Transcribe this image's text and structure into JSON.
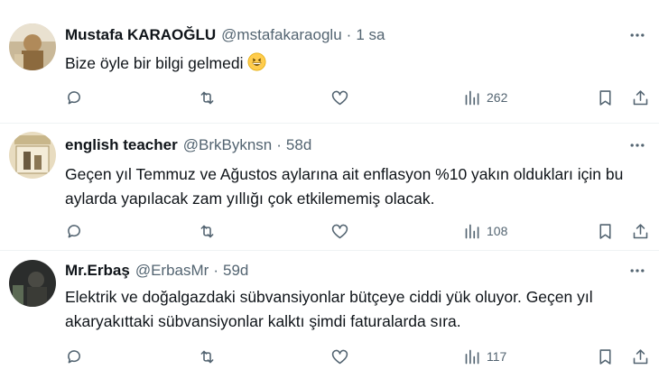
{
  "tweets": [
    {
      "name": "Mustafa KARAOĞLU",
      "handle": "@mstafakaraoglu",
      "separator": "·",
      "time": "1 sa",
      "text": "Bize öyle bir bilgi gelmedi",
      "emoji": "grinning-face-emoji",
      "views": "262"
    },
    {
      "name": "english teacher",
      "handle": "@BrkByknsn",
      "separator": "·",
      "time": "58d",
      "text": "Geçen yıl Temmuz ve Ağustos aylarına ait enflasyon %10 yakın oldukları için bu aylarda yapılacak zam yıllığı çok etkilememiş olacak.",
      "views": "108"
    },
    {
      "name": "Mr.Erbaş",
      "handle": "@ErbasMr",
      "separator": "·",
      "time": "59d",
      "text": "Elektrik ve doğalgazdaki sübvansiyonlar bütçeye ciddi yük oluyor. Geçen yıl akaryakıttaki sübvansiyonlar kalktı şimdi faturalarda sıra.",
      "views": "117"
    }
  ],
  "icons": {
    "reply": "reply-icon",
    "retweet": "retweet-icon",
    "like": "like-icon",
    "views": "views-icon",
    "bookmark": "bookmark-icon",
    "share": "share-icon",
    "more": "more-icon"
  },
  "colors": {
    "text": "#0f1419",
    "secondary": "#536471",
    "divider": "#eff3f4"
  }
}
